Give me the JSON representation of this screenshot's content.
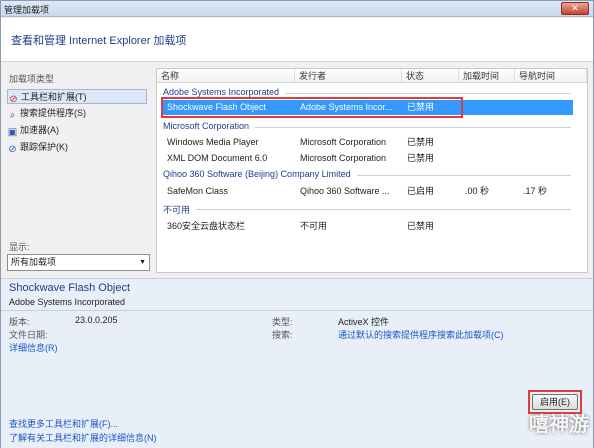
{
  "window": {
    "title": "管理加载项",
    "close": "✕"
  },
  "header": {
    "heading": "查看和管理 Internet Explorer 加载项"
  },
  "sidebar": {
    "types_label": "加载项类型",
    "items": [
      {
        "label": "工具栏和扩展(T)",
        "icon": "gear-icon"
      },
      {
        "label": "搜索提供程序(S)",
        "icon": "search-icon"
      },
      {
        "label": "加速器(A)",
        "icon": "accelerator-icon"
      },
      {
        "label": "跟踪保护(K)",
        "icon": "block-icon"
      }
    ],
    "show_label": "显示:",
    "show_value": "所有加载项"
  },
  "list": {
    "columns": [
      "名称",
      "发行者",
      "状态",
      "加载时间",
      "导航时间"
    ],
    "groups": [
      {
        "name": "Adobe Systems Incorporated",
        "rows": [
          {
            "name": "Shockwave Flash Object",
            "publisher": "Adobe Systems Incor...",
            "status": "已禁用",
            "load": "",
            "nav": ""
          }
        ]
      },
      {
        "name": "Microsoft Corporation",
        "rows": [
          {
            "name": "Windows Media Player",
            "publisher": "Microsoft Corporation",
            "status": "已禁用",
            "load": "",
            "nav": ""
          },
          {
            "name": "XML DOM Document 6.0",
            "publisher": "Microsoft Corporation",
            "status": "已禁用",
            "load": "",
            "nav": ""
          }
        ]
      },
      {
        "name": "Qihoo 360 Software (Beijing) Company Limited",
        "rows": [
          {
            "name": "SafeMon Class",
            "publisher": "Qihoo 360 Software ...",
            "status": "已启用",
            "load": ".00 秒",
            "nav": ".17 秒"
          }
        ]
      },
      {
        "name": "不可用",
        "rows": [
          {
            "name": "360安全云盘状态栏",
            "publisher": "不可用",
            "status": "已禁用",
            "load": "",
            "nav": ""
          }
        ]
      }
    ]
  },
  "details": {
    "name": "Shockwave Flash Object",
    "publisher": "Adobe Systems Incorporated",
    "version_label": "版本:",
    "version_value": "23.0.0.205",
    "date_label": "文件日期:",
    "more_info": "详细信息(R)",
    "type_label": "类型:",
    "type_value": "ActiveX 控件",
    "search_label": "搜索:",
    "search_link": "通过默认的搜索提供程序搜索此加载项(C)",
    "enable_button": "启用(E)",
    "find_more": "查找更多工具栏和扩展(F)...",
    "learn_more": "了解有关工具栏和扩展的详细信息(N)"
  },
  "watermark": "嘻神游"
}
